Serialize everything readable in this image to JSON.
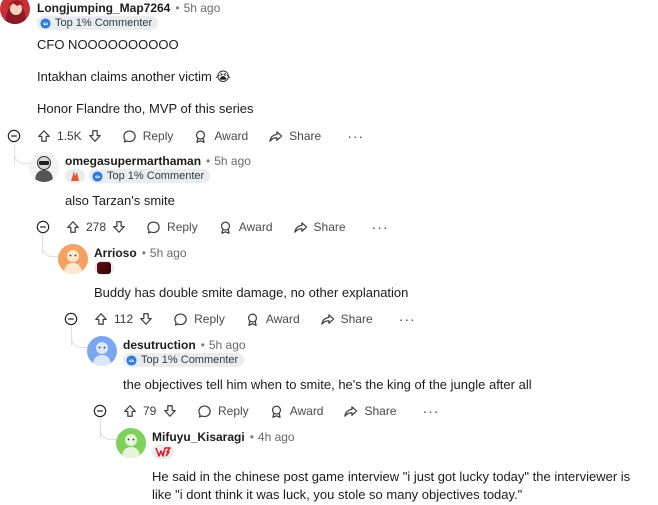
{
  "comments": [
    {
      "author": "Longjumping_Map7264",
      "time": "5h ago",
      "flair": "Top 1% Commenter",
      "body": [
        "CFO NOOOOOOOOOO",
        "Intakhan claims another victim 😭",
        "Honor Flandre tho, MVP of this series"
      ],
      "score": "1.5K",
      "avatar_color": "#d8383f"
    },
    {
      "author": "omegasupermarthaman",
      "time": "5h ago",
      "flair": "Top 1% Commenter",
      "body": [
        "also Tarzan's smite"
      ],
      "score": "278",
      "avatar_color": "#f4f4f4"
    },
    {
      "author": "Arrioso",
      "time": "5h ago",
      "body": [
        "Buddy has double smite damage, no other explanation"
      ],
      "score": "112",
      "avatar_color": "#f4a261"
    },
    {
      "author": "desutruction",
      "time": "5h ago",
      "flair": "Top 1% Commenter",
      "body": [
        "the objectives tell him when to smite, he's the king of the jungle after all"
      ],
      "score": "79",
      "avatar_color": "#7aa5ef"
    },
    {
      "author": "Mifuyu_Kisaragi",
      "time": "4h ago",
      "body": [
        "He said in the chinese post game interview \"i just got lucky today\" the interviewer is like \"i dont think it was luck, you stole so many objectives today.\""
      ]
    }
  ],
  "labels": {
    "reply": "Reply",
    "award": "Award",
    "share": "Share",
    "more": "···",
    "dot": "•"
  },
  "icons": {
    "collapse": "minus-circle-icon",
    "upvote": "arrow-up-icon",
    "downvote": "arrow-down-icon",
    "reply": "speech-bubble-icon",
    "award": "award-icon",
    "share": "share-arrow-icon",
    "flair": "top-commenter-icon"
  },
  "colors": {
    "thread_line": "#dcdfe1",
    "flair_bg": "#eaedef",
    "meta_text": "#6a6a6a"
  }
}
